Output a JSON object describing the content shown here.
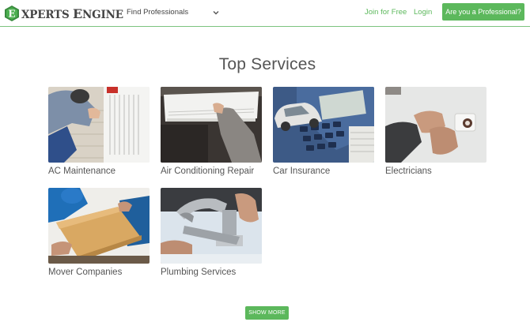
{
  "header": {
    "logo_initial": "E",
    "logo_word1_first": "E",
    "logo_word1_rest": "XPERTS",
    "logo_word2_first": "E",
    "logo_word2_rest": "NGINE",
    "find_label": "Find Professionals",
    "join_label": "Join for Free",
    "login_label": "Login",
    "pro_button_label": "Are you a Professional?"
  },
  "main": {
    "title": "Top Services",
    "services": [
      {
        "label": "AC Maintenance",
        "image": "ac-maintenance-photo"
      },
      {
        "label": "Air Conditioning Repair",
        "image": "air-conditioning-repair-photo"
      },
      {
        "label": "Car Insurance",
        "image": "car-insurance-photo"
      },
      {
        "label": "Electricians",
        "image": "electricians-photo"
      },
      {
        "label": "Mover Companies",
        "image": "mover-companies-photo"
      },
      {
        "label": "Plumbing Services",
        "image": "plumbing-services-photo"
      }
    ],
    "show_more_label": "SHOW MORE"
  },
  "colors": {
    "accent": "#5cb85c",
    "logo_green": "#3a8a3f",
    "text": "#555555"
  }
}
